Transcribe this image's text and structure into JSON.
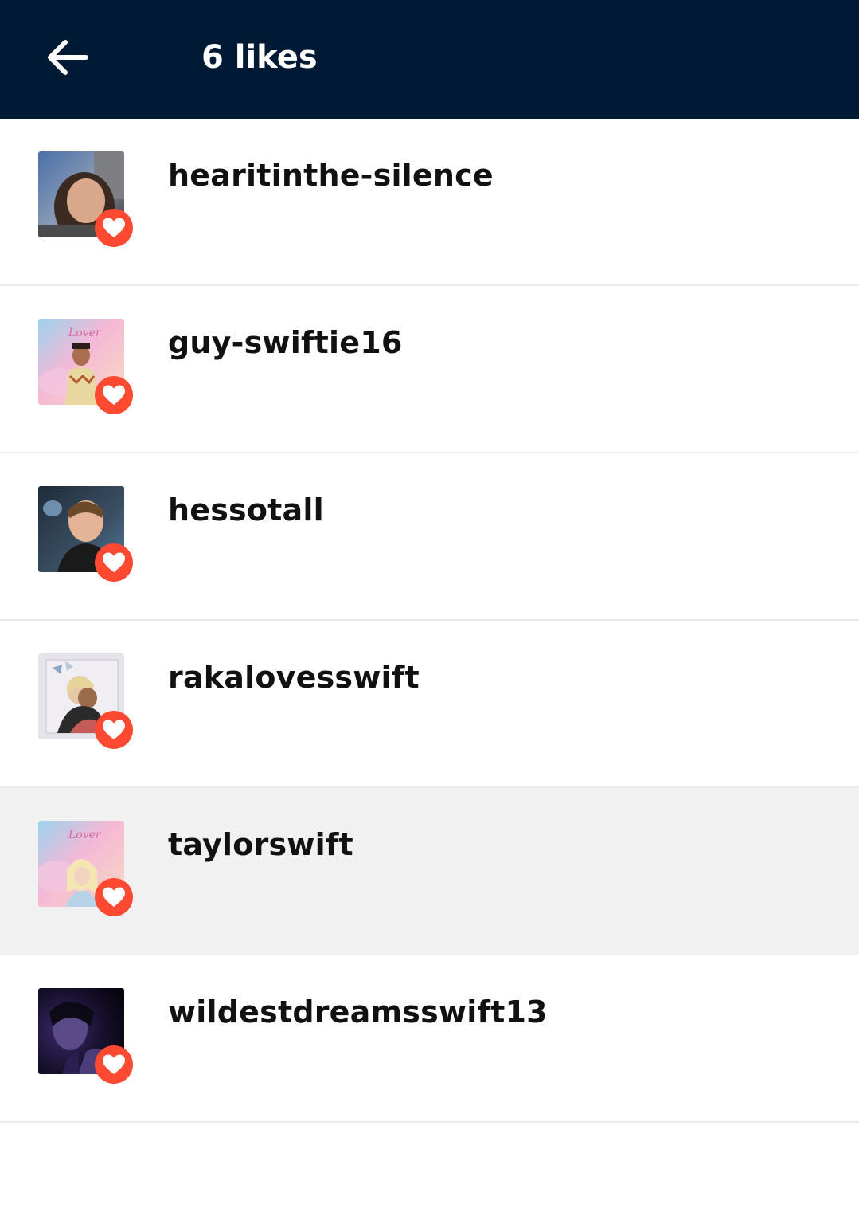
{
  "header": {
    "back_icon": "arrow-left-icon",
    "title": "6 likes",
    "background": "#001935"
  },
  "likes": [
    {
      "username": "hearitinthe-silence",
      "avatar": "profile-photo",
      "highlighted": false
    },
    {
      "username": "guy-swiftie16",
      "avatar": "profile-photo",
      "highlighted": false
    },
    {
      "username": "hessotall",
      "avatar": "profile-photo",
      "highlighted": false
    },
    {
      "username": "rakalovesswift",
      "avatar": "profile-photo",
      "highlighted": false
    },
    {
      "username": "taylorswift",
      "avatar": "profile-photo",
      "highlighted": true
    },
    {
      "username": "wildestdreamsswift13",
      "avatar": "profile-photo",
      "highlighted": false
    }
  ],
  "colors": {
    "heart_badge": "#ff4930",
    "highlight_row": "#f1f1f1"
  }
}
